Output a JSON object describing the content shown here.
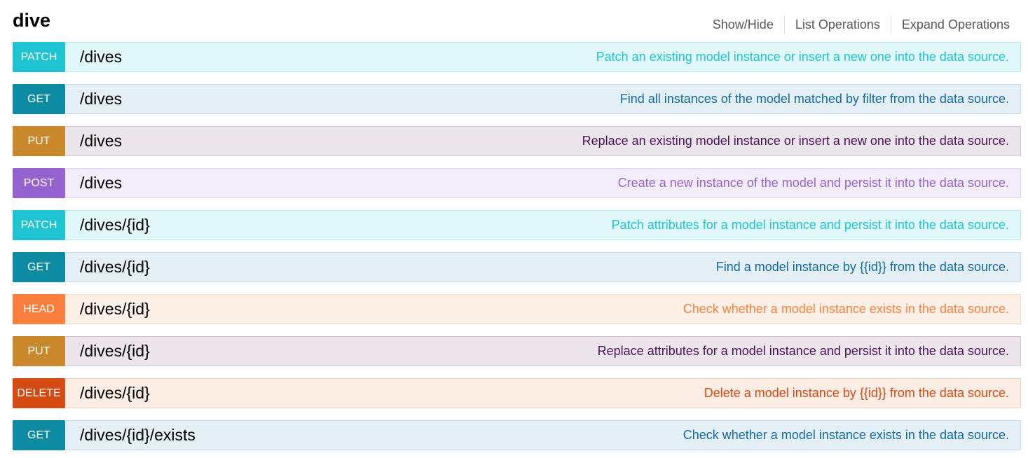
{
  "resource": {
    "title": "dive",
    "actions": {
      "show_hide": "Show/Hide",
      "list_operations": "List Operations",
      "expand_operations": "Expand Operations"
    }
  },
  "colors": {
    "PATCH": {
      "badge": "#1ec4d2",
      "bg": "#e1f7fa",
      "border": "#b6e9ef",
      "text": "#1ec4d2"
    },
    "GET": {
      "badge": "#0c8ba3",
      "bg": "#e4f0f5",
      "border": "#c0dde8",
      "text": "#106ba8"
    },
    "PUT": {
      "badge": "#c8882b",
      "bg": "#ece6ec",
      "border": "#d0c8d0",
      "text": "#4a1358"
    },
    "POST": {
      "badge": "#9563d0",
      "bg": "#f3ecfa",
      "border": "#e0d2f0",
      "text": "#9563d0"
    },
    "HEAD": {
      "badge": "#fb7f3d",
      "bg": "#fdf0e7",
      "border": "#f8d8c5",
      "text": "#fb7f3d"
    },
    "DELETE": {
      "badge": "#d64a14",
      "bg": "#fbece4",
      "border": "#f2d0c1",
      "text": "#d64a14"
    }
  },
  "operations": [
    {
      "method": "PATCH",
      "path": "/dives",
      "summary": "Patch an existing model instance or insert a new one into the data source."
    },
    {
      "method": "GET",
      "path": "/dives",
      "summary": "Find all instances of the model matched by filter from the data source."
    },
    {
      "method": "PUT",
      "path": "/dives",
      "summary": "Replace an existing model instance or insert a new one into the data source."
    },
    {
      "method": "POST",
      "path": "/dives",
      "summary": "Create a new instance of the model and persist it into the data source."
    },
    {
      "method": "PATCH",
      "path": "/dives/{id}",
      "summary": "Patch attributes for a model instance and persist it into the data source."
    },
    {
      "method": "GET",
      "path": "/dives/{id}",
      "summary": "Find a model instance by {{id}} from the data source."
    },
    {
      "method": "HEAD",
      "path": "/dives/{id}",
      "summary": "Check whether a model instance exists in the data source."
    },
    {
      "method": "PUT",
      "path": "/dives/{id}",
      "summary": "Replace attributes for a model instance and persist it into the data source."
    },
    {
      "method": "DELETE",
      "path": "/dives/{id}",
      "summary": "Delete a model instance by {{id}} from the data source."
    },
    {
      "method": "GET",
      "path": "/dives/{id}/exists",
      "summary": "Check whether a model instance exists in the data source."
    }
  ]
}
